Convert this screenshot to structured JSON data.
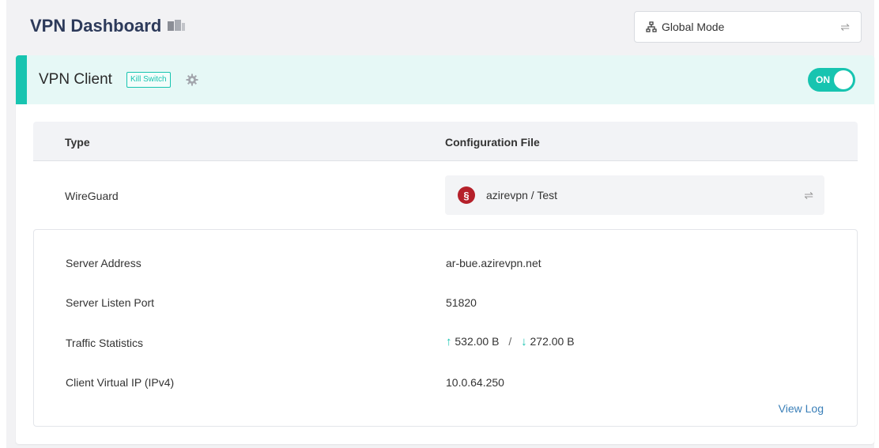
{
  "header": {
    "title": "VPN Dashboard",
    "title_icon": "vpn-badge-icon",
    "mode_select": {
      "value": "Global Mode",
      "icon": "network-icon",
      "swap_icon": "swap-icon"
    }
  },
  "card": {
    "title": "VPN Client",
    "kill_switch_label": "Kill Switch",
    "toggle_label": "ON",
    "accent_color": "#17c4b0",
    "table": {
      "col_type": "Type",
      "col_config": "Configuration File",
      "type_value": "WireGuard",
      "config_value": "azirevpn / Test"
    },
    "details": {
      "rows": [
        {
          "label": "Server Address",
          "value": "ar-bue.azirevpn.net"
        },
        {
          "label": "Server Listen Port",
          "value": "51820"
        },
        {
          "label": "Traffic Statistics",
          "upload": "532.00 B",
          "separator": "/",
          "download": "272.00 B"
        },
        {
          "label": "Client Virtual IP (IPv4)",
          "value": "10.0.64.250"
        }
      ],
      "view_log": "View Log"
    }
  }
}
